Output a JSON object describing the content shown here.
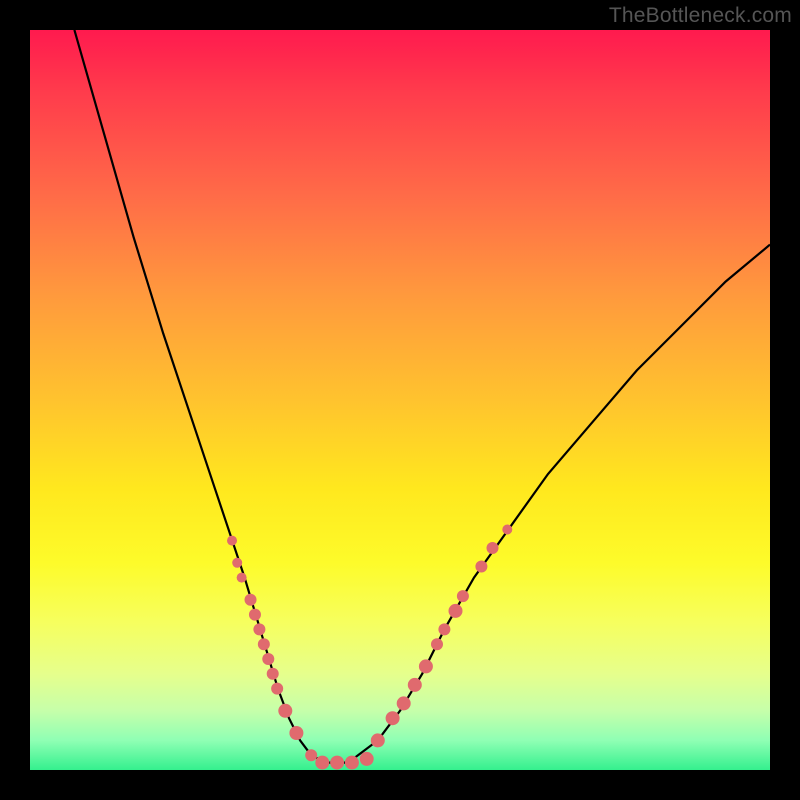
{
  "watermark": "TheBottleneck.com",
  "colors": {
    "background": "#000000",
    "curve": "#000000",
    "marker": "#e06a6e",
    "gradient_top": "#ff1a4e",
    "gradient_bottom": "#34f08e"
  },
  "chart_data": {
    "type": "line",
    "title": "",
    "xlabel": "",
    "ylabel": "",
    "xlim": [
      0,
      100
    ],
    "ylim": [
      0,
      100
    ],
    "curve": {
      "x": [
        6,
        10,
        14,
        18,
        22,
        25,
        27,
        29,
        30.5,
        32,
        33.5,
        35,
        36.5,
        38,
        40,
        43,
        47,
        50,
        53,
        56,
        60,
        65,
        70,
        76,
        82,
        88,
        94,
        100
      ],
      "y": [
        100,
        86,
        72,
        59,
        47,
        38,
        32,
        26,
        21,
        16,
        11,
        7,
        4,
        2,
        1,
        1,
        4,
        8,
        13,
        19,
        26,
        33,
        40,
        47,
        54,
        60,
        66,
        71
      ]
    },
    "markers_left": {
      "x": [
        27.3,
        28.0,
        28.6,
        29.8,
        30.4,
        31.0,
        31.6,
        32.2,
        32.8,
        33.4,
        34.5,
        36.0,
        38.0
      ],
      "y": [
        31.0,
        28.0,
        26.0,
        23.0,
        21.0,
        19.0,
        17.0,
        15.0,
        13.0,
        11.0,
        8.0,
        5.0,
        2.0
      ],
      "r": [
        5,
        5,
        5,
        6,
        6,
        6,
        6,
        6,
        6,
        6,
        7,
        7,
        6
      ]
    },
    "flat_bottom": {
      "x": [
        39.5,
        41.5,
        43.5,
        45.5
      ],
      "y": [
        1,
        1,
        1,
        1.5
      ],
      "r": [
        7,
        7,
        7,
        7
      ]
    },
    "markers_right": {
      "x": [
        47.0,
        49.0,
        50.5,
        52.0,
        53.5,
        55.0,
        56.0,
        57.5,
        58.5,
        61.0,
        62.5,
        64.5
      ],
      "y": [
        4.0,
        7.0,
        9.0,
        11.5,
        14.0,
        17.0,
        19.0,
        21.5,
        23.5,
        27.5,
        30.0,
        32.5
      ],
      "r": [
        7,
        7,
        7,
        7,
        7,
        6,
        6,
        7,
        6,
        6,
        6,
        5
      ]
    }
  }
}
